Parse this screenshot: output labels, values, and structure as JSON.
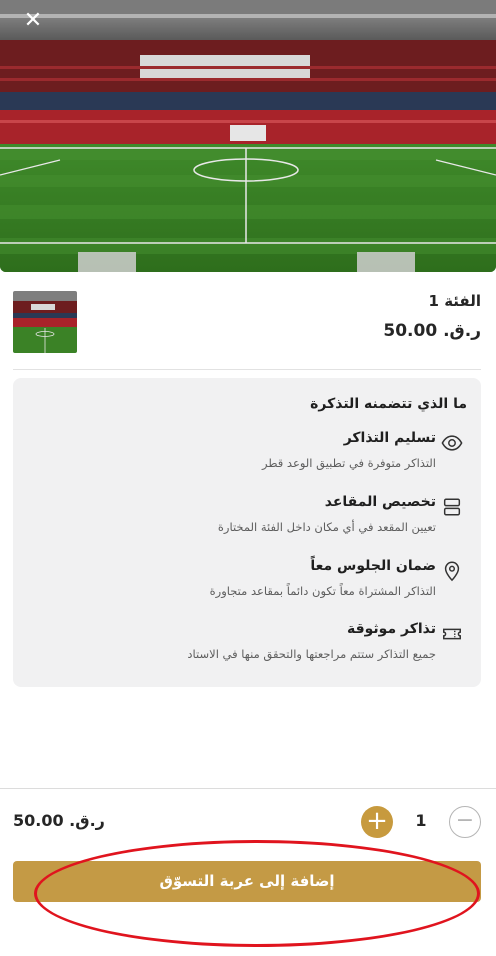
{
  "modal": {
    "close_label": "✕"
  },
  "product": {
    "name": "الفئة 1",
    "price": "ر.ق. 50.00"
  },
  "includes": {
    "title": "ما الذي تتضمنه التذكرة",
    "features": [
      {
        "title": "تسليم التذاكر",
        "desc": "التذاكر متوفرة في تطبيق الوعد قطر",
        "icon": "eye-icon"
      },
      {
        "title": "تخصيص المقاعد",
        "desc": "تعيين المقعد في أي مكان داخل الفئة المختارة",
        "icon": "seat-rows-icon"
      },
      {
        "title": "ضمان الجلوس معاً",
        "desc": "التذاكر المشتراة معاً تكون دائماً بمقاعد متجاورة",
        "icon": "map-pin-icon"
      },
      {
        "title": "تذاكر موثوقة",
        "desc": "جميع التذاكر ستتم مراجعتها والتحقق منها في الاستاد",
        "icon": "ticket-icon"
      }
    ]
  },
  "footer": {
    "total": "ر.ق. 50.00",
    "quantity": "1",
    "plus_label": "+",
    "minus_label": "−",
    "add_to_cart": "إضافة إلى عربة التسوّق"
  },
  "colors": {
    "accent": "#c49a45",
    "card_bg": "#f1f1f2",
    "annotation": "#e0141e"
  }
}
